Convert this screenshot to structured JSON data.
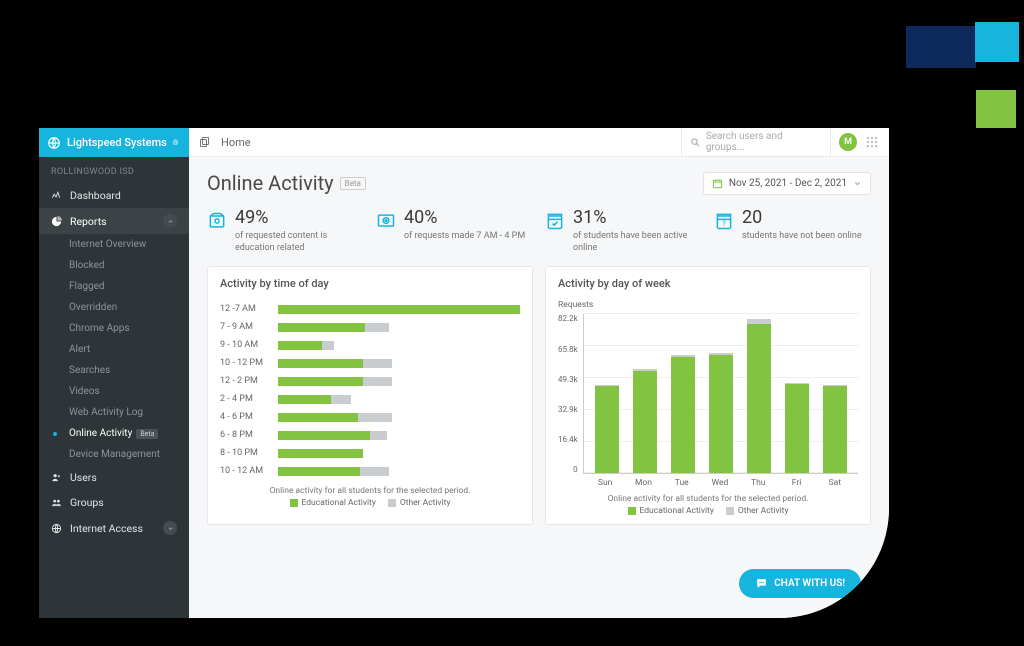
{
  "brand": "Lightspeed Systems",
  "breadcrumb": "Home",
  "search_placeholder": "Search users and groups...",
  "avatar_initial": "M",
  "org": "ROLLINGWOOD ISD",
  "sidebar": {
    "dashboard": "Dashboard",
    "reports": "Reports",
    "subs": [
      "Internet Overview",
      "Blocked",
      "Flagged",
      "Overridden",
      "Chrome Apps",
      "Alert",
      "Searches",
      "Videos",
      "Web Activity Log",
      "Online Activity",
      "Device Management"
    ],
    "beta": "Beta",
    "users": "Users",
    "groups": "Groups",
    "internet": "Internet Access"
  },
  "page_title": "Online Activity",
  "beta_badge": "Beta",
  "date_range": "Nov 25, 2021 - Dec 2, 2021",
  "stats": [
    {
      "value": "49%",
      "text": "of requested content is education related"
    },
    {
      "value": "40%",
      "text": "of requests made 7 AM - 4 PM"
    },
    {
      "value": "31%",
      "text": "of students have been active online"
    },
    {
      "value": "20",
      "text": "students have not been online"
    }
  ],
  "legend": {
    "edu": "Educational Activity",
    "other": "Other Activity"
  },
  "colors": {
    "edu": "#82c341",
    "other": "#c9cdd0",
    "accent": "#16b5de"
  },
  "time_chart": {
    "title": "Activity by time of day",
    "note": "Online activity for all students for the selected period."
  },
  "week_chart": {
    "title": "Activity by day of week",
    "ylabel": "Requests",
    "note": "Online activity for all students for the selected period."
  },
  "chat_label": "CHAT WITH US!",
  "chart_data": [
    {
      "type": "bar",
      "orientation": "horizontal",
      "title": "Activity by time of day",
      "xlabel": "",
      "ylabel": "",
      "categories": [
        "12 -7 AM",
        "7 - 9 AM",
        "9 - 10 AM",
        "10 - 12 PM",
        "12 - 2 PM",
        "2 - 4 PM",
        "4 - 6 PM",
        "6 - 8 PM",
        "8 - 10 PM",
        "10 - 12 AM"
      ],
      "series": [
        {
          "name": "Educational Activity",
          "values": [
            100,
            36,
            18,
            35,
            35,
            22,
            33,
            38,
            35,
            34
          ]
        },
        {
          "name": "Other Activity",
          "values": [
            0,
            10,
            5,
            12,
            12,
            8,
            14,
            7,
            0,
            12
          ]
        }
      ],
      "xlim": [
        0,
        100
      ]
    },
    {
      "type": "bar",
      "orientation": "vertical",
      "title": "Activity by day of week",
      "ylabel": "Requests",
      "categories": [
        "Sun",
        "Mon",
        "Tue",
        "Wed",
        "Thu",
        "Fri",
        "Sat"
      ],
      "series": [
        {
          "name": "Educational Activity",
          "values": [
            45000,
            53000,
            60000,
            61000,
            77000,
            46000,
            45000
          ]
        },
        {
          "name": "Other Activity",
          "values": [
            500,
            1000,
            1200,
            1200,
            2800,
            800,
            500
          ]
        }
      ],
      "ylim": [
        0,
        82200
      ],
      "yticks": [
        0,
        16400,
        32900,
        49300,
        65800,
        82200
      ],
      "ytick_labels": [
        "0",
        "16.4k",
        "32.9k",
        "49.3k",
        "65.8k",
        "82.2k"
      ]
    }
  ]
}
